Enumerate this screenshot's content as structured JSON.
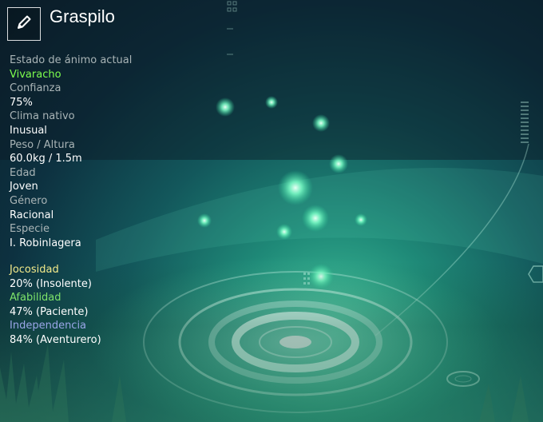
{
  "character": {
    "name": "Graspilo"
  },
  "icons": {
    "edit": "pencil-icon"
  },
  "stats": [
    {
      "label": "Estado de ánimo actual",
      "value": "Vivaracho"
    },
    {
      "label": "Confianza",
      "value": "75%"
    },
    {
      "label": "Clima nativo",
      "value": "Inusual"
    },
    {
      "label": "Peso / Altura",
      "value": "60.0kg / 1.5m"
    },
    {
      "label": "Edad",
      "value": "Joven"
    },
    {
      "label": "Género",
      "value": "Racional"
    },
    {
      "label": "Especie",
      "value": "I. Robinlagera"
    }
  ],
  "traits": [
    {
      "label": "Jocosidad",
      "value": "20% (Insolente)",
      "color": "#f2e98a"
    },
    {
      "label": "Afabilidad",
      "value": "47% (Paciente)",
      "color": "#7de36a"
    },
    {
      "label": "Independencia",
      "value": "84% (Aventurero)",
      "color": "#9aa6e8"
    }
  ],
  "colors": {
    "mood_value": "#7dff4e",
    "label_gray": "#a9b4b6"
  }
}
